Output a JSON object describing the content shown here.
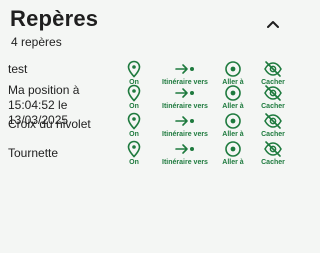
{
  "panel": {
    "title": "Repères",
    "subtitle": "4 repères",
    "collapse_icon": "chevron-up-icon",
    "accent_color": "#1e7a3e"
  },
  "actions": {
    "on_label": "On",
    "itinerary_label": "Itinéraire vers",
    "goto_label": "Aller à",
    "hide_label": "Cacher"
  },
  "markers": [
    {
      "name": "test"
    },
    {
      "name": "Ma position à 15:04:52 le 13/03/2025"
    },
    {
      "name": "Croix du nivolet"
    },
    {
      "name": "Tournette"
    }
  ]
}
